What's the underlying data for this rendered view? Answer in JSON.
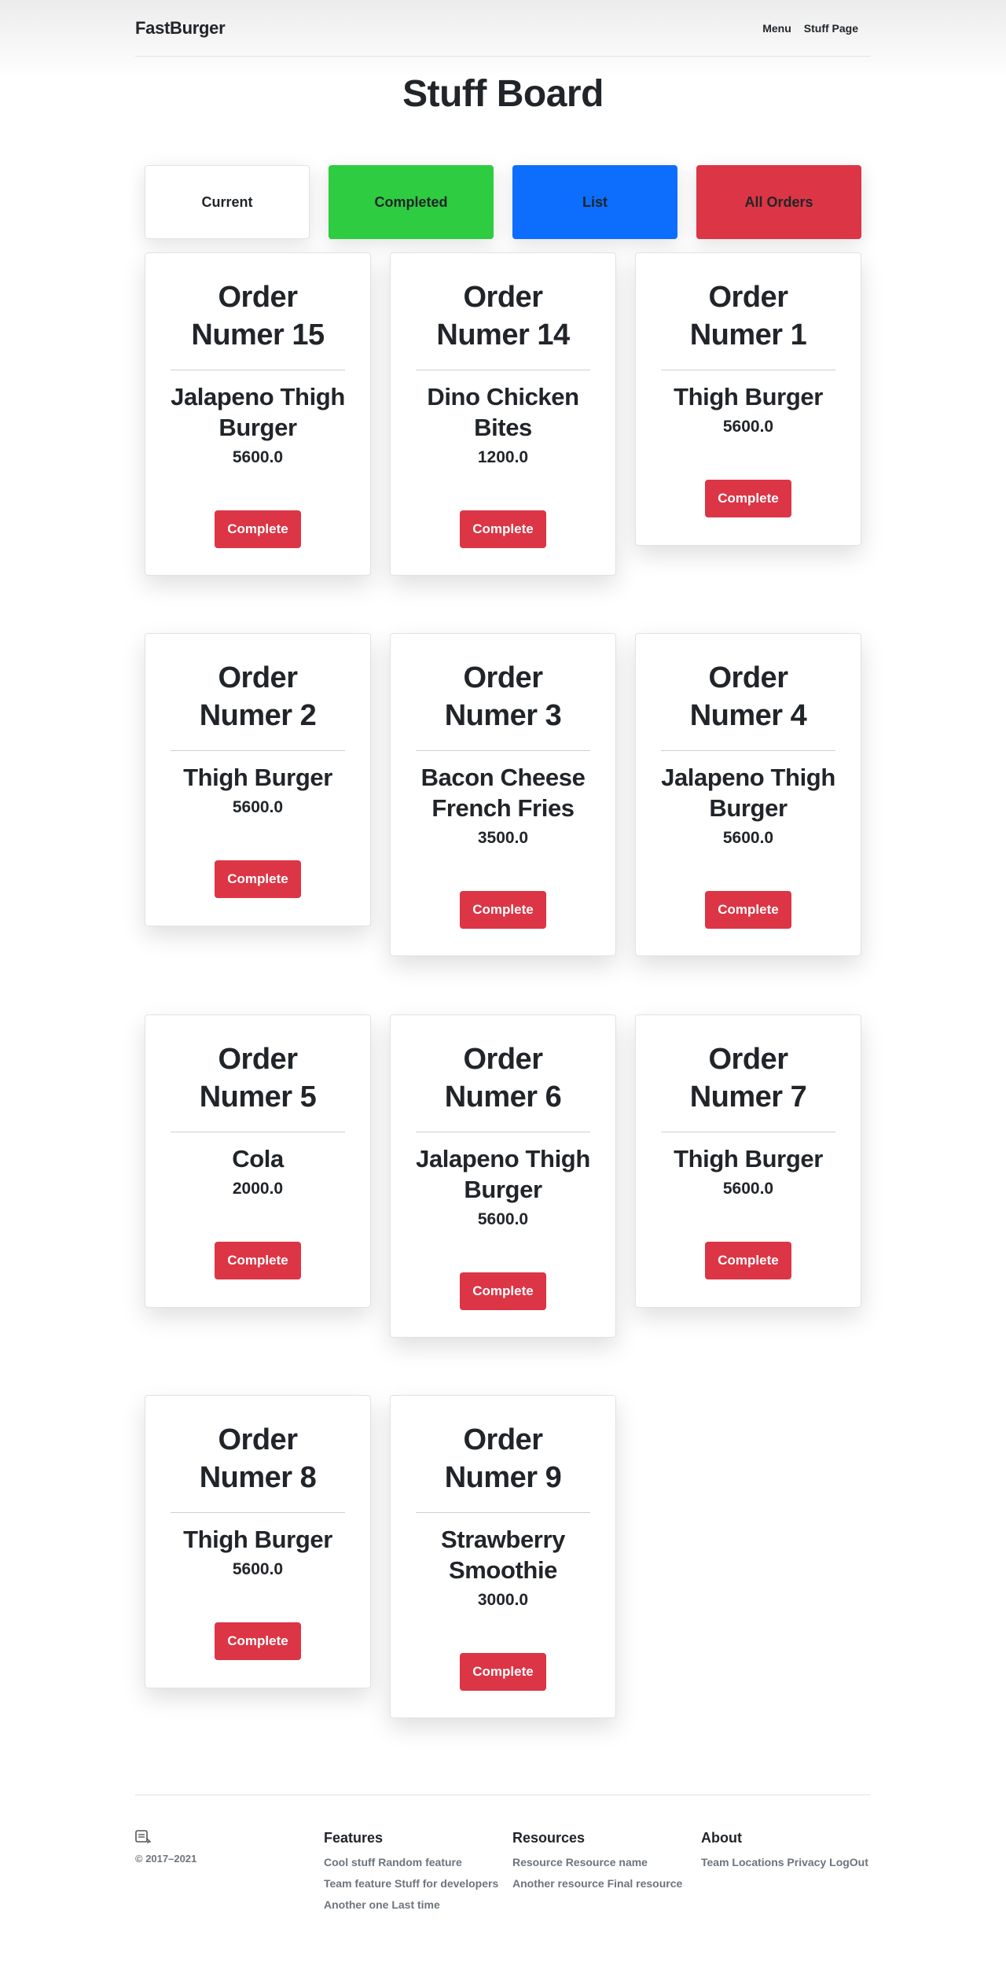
{
  "header": {
    "brand": "FastBurger",
    "nav": [
      {
        "label": "Menu"
      },
      {
        "label": "Stuff Page"
      }
    ]
  },
  "page_title": "Stuff Board",
  "filters": [
    {
      "label": "Current",
      "color": "#ffffff"
    },
    {
      "label": "Completed",
      "color": "#2ecc40"
    },
    {
      "label": "List",
      "color": "#0d6efd"
    },
    {
      "label": "All Orders",
      "color": "#dc3545"
    }
  ],
  "orders": [
    {
      "title": "Order Numer 15",
      "item": "Jalapeno Thigh Burger",
      "price": "5600.0",
      "button": "Complete"
    },
    {
      "title": "Order Numer 14",
      "item": "Dino Chicken Bites",
      "price": "1200.0",
      "button": "Complete"
    },
    {
      "title": "Order Numer 1",
      "item": "Thigh Burger",
      "price": "5600.0",
      "button": "Complete"
    },
    {
      "title": "Order Numer 2",
      "item": "Thigh Burger",
      "price": "5600.0",
      "button": "Complete"
    },
    {
      "title": "Order Numer 3",
      "item": "Bacon Cheese French Fries",
      "price": "3500.0",
      "button": "Complete"
    },
    {
      "title": "Order Numer 4",
      "item": "Jalapeno Thigh Burger",
      "price": "5600.0",
      "button": "Complete"
    },
    {
      "title": "Order Numer 5",
      "item": "Cola",
      "price": "2000.0",
      "button": "Complete"
    },
    {
      "title": "Order Numer 6",
      "item": "Jalapeno Thigh Burger",
      "price": "5600.0",
      "button": "Complete"
    },
    {
      "title": "Order Numer 7",
      "item": "Thigh Burger",
      "price": "5600.0",
      "button": "Complete"
    },
    {
      "title": "Order Numer 8",
      "item": "Thigh Burger",
      "price": "5600.0",
      "button": "Complete"
    },
    {
      "title": "Order Numer 9",
      "item": "Strawberry Smoothie",
      "price": "3000.0",
      "button": "Complete"
    }
  ],
  "footer": {
    "copyright": "© 2017–2021",
    "logo_icon": "bookmark-logo-icon",
    "columns": [
      {
        "heading": "Features",
        "links": [
          "Cool stuff Random feature",
          "Team feature Stuff for developers",
          "Another one Last time"
        ]
      },
      {
        "heading": "Resources",
        "links": [
          "Resource Resource name",
          "Another resource Final resource"
        ]
      },
      {
        "heading": "About",
        "links": [
          "Team Locations Privacy LogOut"
        ]
      }
    ]
  }
}
